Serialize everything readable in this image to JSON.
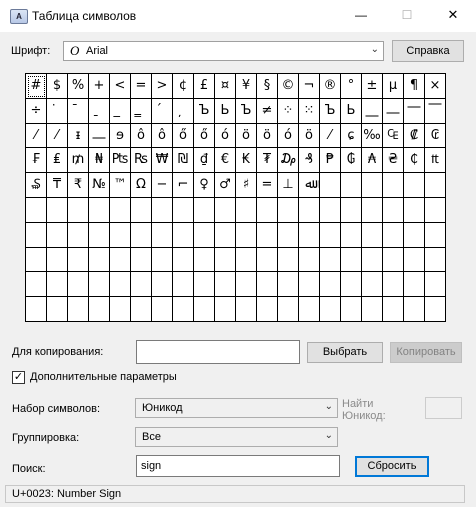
{
  "window": {
    "title": "Таблица символов",
    "icon": "charmap-icon",
    "minimize": "—",
    "maximize": "☐",
    "close": "✕"
  },
  "font": {
    "label": "Шрифт:",
    "value": "Arial",
    "glyph": "O",
    "help_button": "Справка"
  },
  "grid_rows": [
    [
      "#",
      "$",
      "%",
      "+",
      "<",
      "=",
      ">",
      "¢",
      "£",
      "¤",
      "¥",
      "§",
      "©",
      "¬",
      "®",
      "°",
      "±",
      "µ",
      "¶",
      "×"
    ],
    [
      "÷",
      "̇",
      "̄",
      "̱",
      "̲",
      "̳",
      "́",
      "̦",
      "Ъ",
      "Ь",
      "Ъ",
      "≠",
      "⁘",
      "⁙",
      "Ъ",
      "Ь",
      "⎽",
      "⎼",
      "⎻",
      "⎺"
    ],
    [
      "⁄",
      "⁄",
      "ᵻ",
      "⎼",
      "ɘ",
      "ô",
      "ô",
      "ő",
      "ő",
      "ó",
      "ö",
      "ö",
      "ó",
      "ö",
      "⁄",
      "ɕ",
      "‰",
      "₠",
      "₡",
      "₢"
    ],
    [
      "₣",
      "₤",
      "₥",
      "₦",
      "₧",
      "₨",
      "₩",
      "₪",
      "₫",
      "€",
      "₭",
      "₮",
      "₯",
      "₰",
      "₱",
      "₲",
      "₳",
      "₴",
      "₵",
      "₶"
    ],
    [
      "₷",
      "₸",
      "₹",
      "№",
      "™",
      "Ω",
      "−",
      "⌐",
      "♀",
      "♂",
      "♯",
      "=",
      "⊥",
      "ﷲ",
      "",
      "",
      "",
      "",
      "",
      ""
    ],
    [
      "",
      "",
      "",
      "",
      "",
      "",
      "",
      "",
      "",
      "",
      "",
      "",
      "",
      "",
      "",
      "",
      "",
      "",
      "",
      ""
    ],
    [
      "",
      "",
      "",
      "",
      "",
      "",
      "",
      "",
      "",
      "",
      "",
      "",
      "",
      "",
      "",
      "",
      "",
      "",
      "",
      ""
    ],
    [
      "",
      "",
      "",
      "",
      "",
      "",
      "",
      "",
      "",
      "",
      "",
      "",
      "",
      "",
      "",
      "",
      "",
      "",
      "",
      ""
    ],
    [
      "",
      "",
      "",
      "",
      "",
      "",
      "",
      "",
      "",
      "",
      "",
      "",
      "",
      "",
      "",
      "",
      "",
      "",
      "",
      ""
    ],
    [
      "",
      "",
      "",
      "",
      "",
      "",
      "",
      "",
      "",
      "",
      "",
      "",
      "",
      "",
      "",
      "",
      "",
      "",
      "",
      ""
    ]
  ],
  "copy": {
    "label": "Для копирования:",
    "value": "",
    "select_button": "Выбрать",
    "copy_button": "Копировать"
  },
  "advanced": {
    "label": "Дополнительные параметры",
    "checked": "✓"
  },
  "charset": {
    "label": "Набор символов:",
    "value": "Юникод",
    "find_unicode_label": "Найти Юникод:",
    "find_unicode_value": ""
  },
  "grouping": {
    "label": "Группировка:",
    "value": "Все"
  },
  "search": {
    "label": "Поиск:",
    "value": "sign",
    "reset_button": "Сбросить"
  },
  "status": "U+0023: Number Sign"
}
